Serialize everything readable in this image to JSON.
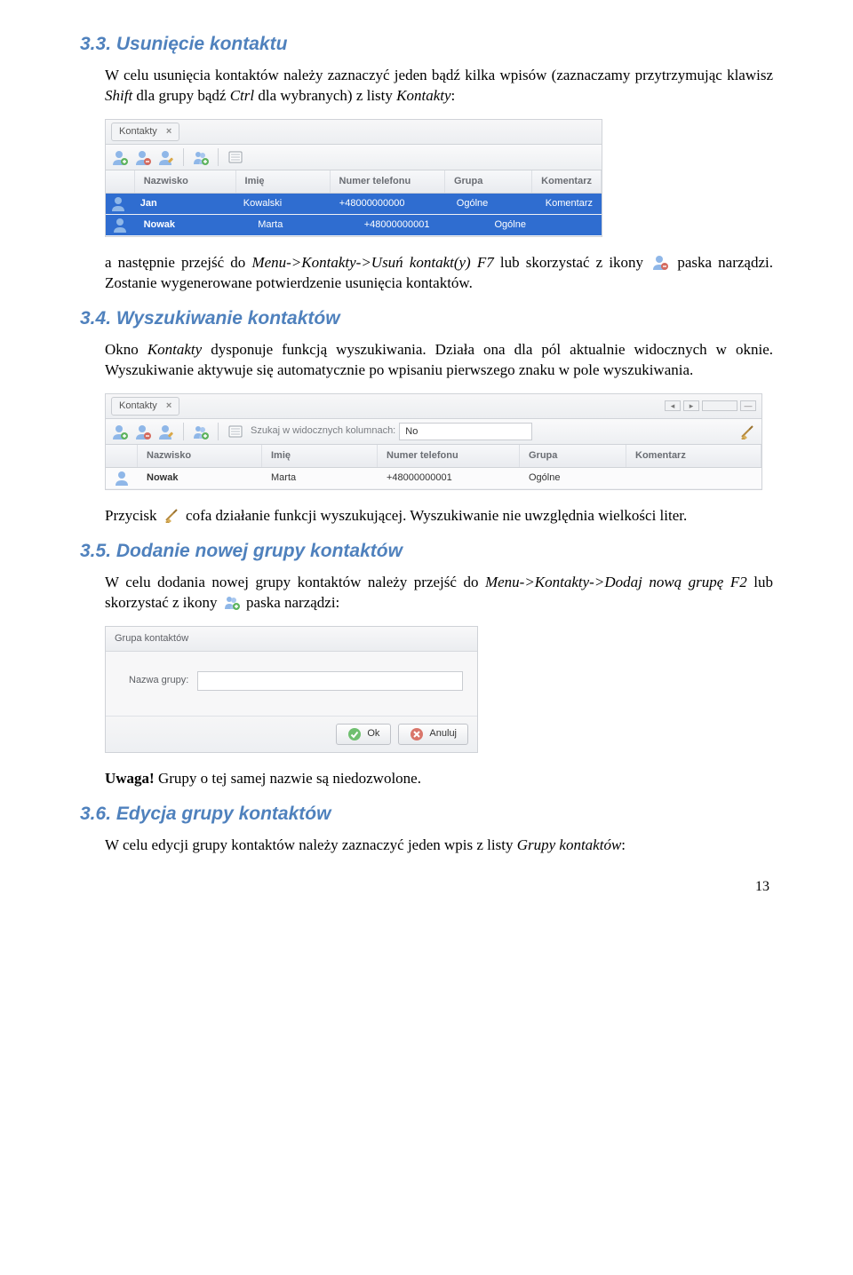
{
  "sections": {
    "s33": {
      "num": "3.3.",
      "title": "Usunięcie kontaktu",
      "para": "W celu usunięcia kontaktów należy zaznaczyć jeden bądź kilka wpisów (zaznaczamy przytrzymując klawisz ",
      "em1": "Shift",
      "mid1": " dla grupy bądź ",
      "em2": "Ctrl",
      "mid2": " dla wybranych) z listy ",
      "em3": "Kontakty",
      "end": ":",
      "after1a": "a następnie przejść do ",
      "after1em": "Menu->Kontakty->Usuń kontakt(y) F7",
      "after1b": " lub skorzystać z ikony ",
      "after1c": " paska narządzi. Zostanie wygenerowane potwierdzenie usunięcia kontaktów."
    },
    "s34": {
      "num": "3.4.",
      "title": "Wyszukiwanie kontaktów",
      "p1a": "Okno ",
      "p1em": "Kontakty",
      "p1b": " dysponuje funkcją wyszukiwania. Działa ona dla pól aktualnie widocznych w oknie. Wyszukiwanie aktywuje się automatycznie po wpisaniu pierwszego znaku w pole wyszukiwania.",
      "p2a": "Przycisk ",
      "p2b": " cofa działanie funkcji wyszukującej. Wyszukiwanie nie uwzględnia wielkości liter."
    },
    "s35": {
      "num": "3.5.",
      "title": "Dodanie nowej grupy kontaktów",
      "p1a": "W celu dodania nowej grupy kontaktów należy przejść do ",
      "p1em": "Menu->Kontakty->Dodaj nową grupę F2",
      "p1b": " lub skorzystać z ikony ",
      "p1c": " paska narządzi:",
      "warnlabel": "Uwaga!",
      "warn": " Grupy o tej samej nazwie są niedozwolone."
    },
    "s36": {
      "num": "3.6.",
      "title": "Edycja grupy kontaktów",
      "p1a": "W celu edycji grupy kontaktów należy zaznaczyć jeden wpis z listy ",
      "p1em": "Grupy kontaktów",
      "p1b": ":"
    }
  },
  "panel_common": {
    "tab": "Kontakty",
    "headers": {
      "naz": "Nazwisko",
      "imie": "Imię",
      "tel": "Numer telefonu",
      "grp": "Grupa",
      "kom": "Komentarz"
    }
  },
  "panel1": {
    "rows": [
      {
        "naz": "Jan",
        "imie": "Kowalski",
        "tel": "+48000000000",
        "grp": "Ogólne",
        "kom": "Komentarz",
        "selected": true
      },
      {
        "naz": "Nowak",
        "imie": "Marta",
        "tel": "+48000000001",
        "grp": "Ogólne",
        "kom": "",
        "selected": true
      }
    ]
  },
  "panel2": {
    "search_label": "Szukaj w widocznych kolumnach:",
    "search_value": "No",
    "rows": [
      {
        "naz": "Nowak",
        "imie": "Marta",
        "tel": "+48000000001",
        "grp": "Ogólne",
        "kom": ""
      }
    ]
  },
  "dialog": {
    "title": "Grupa kontaktów",
    "label": "Nazwa grupy:",
    "ok": "Ok",
    "cancel": "Anuluj"
  },
  "page": "13"
}
